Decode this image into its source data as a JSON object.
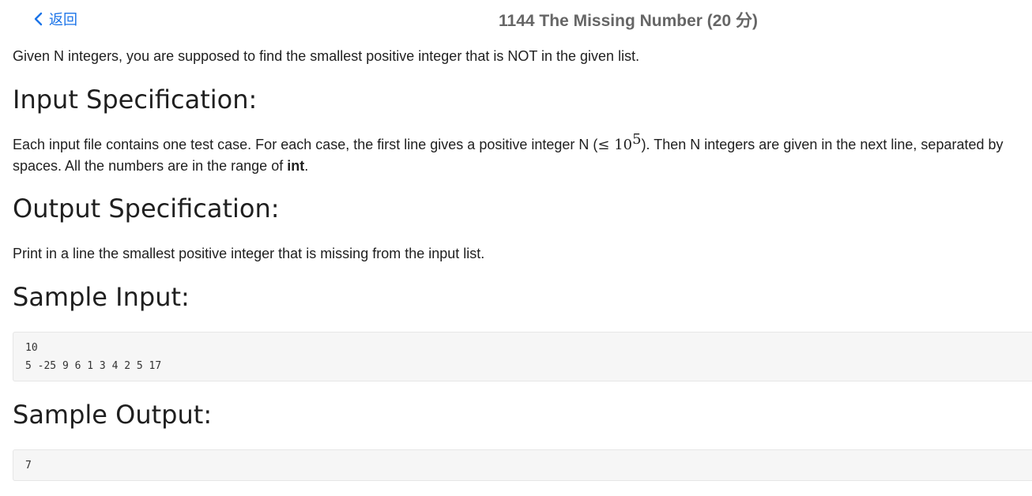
{
  "header": {
    "back_label": "返回",
    "title": "1144 The Missing Number (20 分)"
  },
  "problem": {
    "intro": "Given N integers, you are supposed to find the smallest positive integer that is NOT in the given list.",
    "input_heading": "Input Specification:",
    "input_text_1": "Each input file contains one test case. For each case, the first line gives a positive integer N (",
    "input_math_le": "≤ 10",
    "input_math_exp": "5",
    "input_text_2": "). Then N integers are given in the next line, separated by spaces. All the numbers are in the range of ",
    "input_bold": "int",
    "input_text_3": ".",
    "output_heading": "Output Specification:",
    "output_text": "Print in a line the smallest positive integer that is missing from the input list.",
    "sample_input_heading": "Sample Input:",
    "sample_input": "10\n5 -25 9 6 1 3 4 2 5 17",
    "sample_output_heading": "Sample Output:",
    "sample_output": "7"
  },
  "colors": {
    "link": "#1a73e8",
    "title": "#666666",
    "code_bg": "#f6f6f6"
  }
}
